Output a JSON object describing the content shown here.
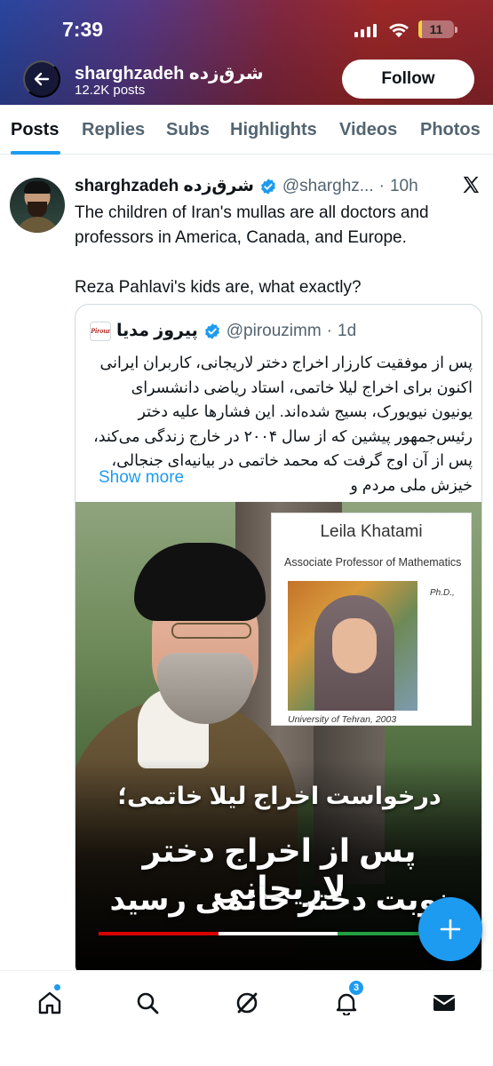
{
  "status_bar": {
    "time": "7:39",
    "battery": "11",
    "battery_level_percent": 11
  },
  "header": {
    "name": "sharghzadeh شرق‌زده",
    "posts_count": "12.2K posts",
    "follow_label": "Follow"
  },
  "tabs": [
    {
      "label": "Posts",
      "active": true
    },
    {
      "label": "Replies",
      "active": false
    },
    {
      "label": "Subs",
      "active": false
    },
    {
      "label": "Highlights",
      "active": false
    },
    {
      "label": "Videos",
      "active": false
    },
    {
      "label": "Photos",
      "active": false
    }
  ],
  "tweet": {
    "name": "sharghzadeh شرق‌زده",
    "handle": "@sharghz...",
    "dot": "·",
    "time": "10h",
    "text_line1": "The children of Iran's mullas are all doctors and professors in America, Canada, and Europe.",
    "text_line2": "Reza Pahlavi's kids are, what exactly?"
  },
  "quote": {
    "logo_text": "Pirouz",
    "name": "پیروز مدیا",
    "handle": "@pirouzimm",
    "dot": "·",
    "time": "1d",
    "text": "پس از موفقیت کارزار اخراج دختر لاریجانی، کاربران ایرانی اکنون برای اخراج لیلا خاتمی، استاد ریاضی دانشسرای یونیون نیویورک، بسیج شده‌اند. این فشارها علیه دختر رئیس‌جمهور پیشین که از سال ۲۰۰۴ در خارج زندگی می‌کند، پس از آن اوج گرفت که محمد خاتمی در بیانیه‌ای جنجالی، خیزش ملی مردم و",
    "show_more": "Show more",
    "image": {
      "inset_title": "Leila Khatami",
      "inset_role": "Associate Professor of Mathematics",
      "inset_degree": "Ph.D.,",
      "inset_caption": "University of Tehran, 2003",
      "overlay_line1": "درخواست اخراج لیلا خاتمی؛",
      "overlay_line2": "پس از اخراج دختر لاریجانی",
      "overlay_line3": "نوبت دختر خاتمی رسید"
    }
  },
  "fab": {
    "icon": "plus-icon"
  },
  "bottom_nav": {
    "items": [
      "home-icon",
      "search-icon",
      "grok-icon",
      "notifications-icon",
      "messages-icon"
    ],
    "notifications_badge": "3"
  },
  "colors": {
    "accent": "#1d9bf0",
    "text": "#0f1419",
    "secondary_text": "#536471",
    "flag_red": "#da0000",
    "flag_white": "#ffffff",
    "flag_green": "#239f40"
  }
}
